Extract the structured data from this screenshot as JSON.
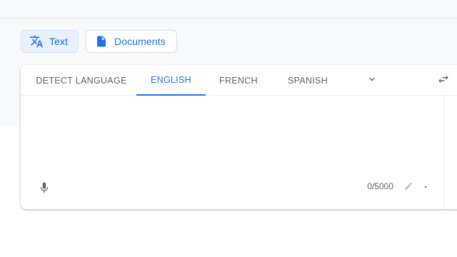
{
  "modes": {
    "text_label": "Text",
    "text_icon": "translate-icon",
    "documents_label": "Documents",
    "documents_icon": "document-icon"
  },
  "source": {
    "tabs": [
      {
        "label": "DETECT LANGUAGE",
        "active": false
      },
      {
        "label": "ENGLISH",
        "active": true
      },
      {
        "label": "FRENCH",
        "active": false
      },
      {
        "label": "SPANISH",
        "active": false
      }
    ],
    "more_icon": "chevron-down-icon",
    "swap_icon": "swap-languages-icon",
    "input_value": "",
    "mic_icon": "microphone-icon",
    "char_count": "0/5000",
    "handwriting_icon": "pencil-icon",
    "handwriting_dropdown_icon": "caret-down-icon"
  },
  "colors": {
    "accent": "#1a73e8",
    "text_secondary": "#5f6368",
    "band_bg": "#f8f9fa"
  }
}
